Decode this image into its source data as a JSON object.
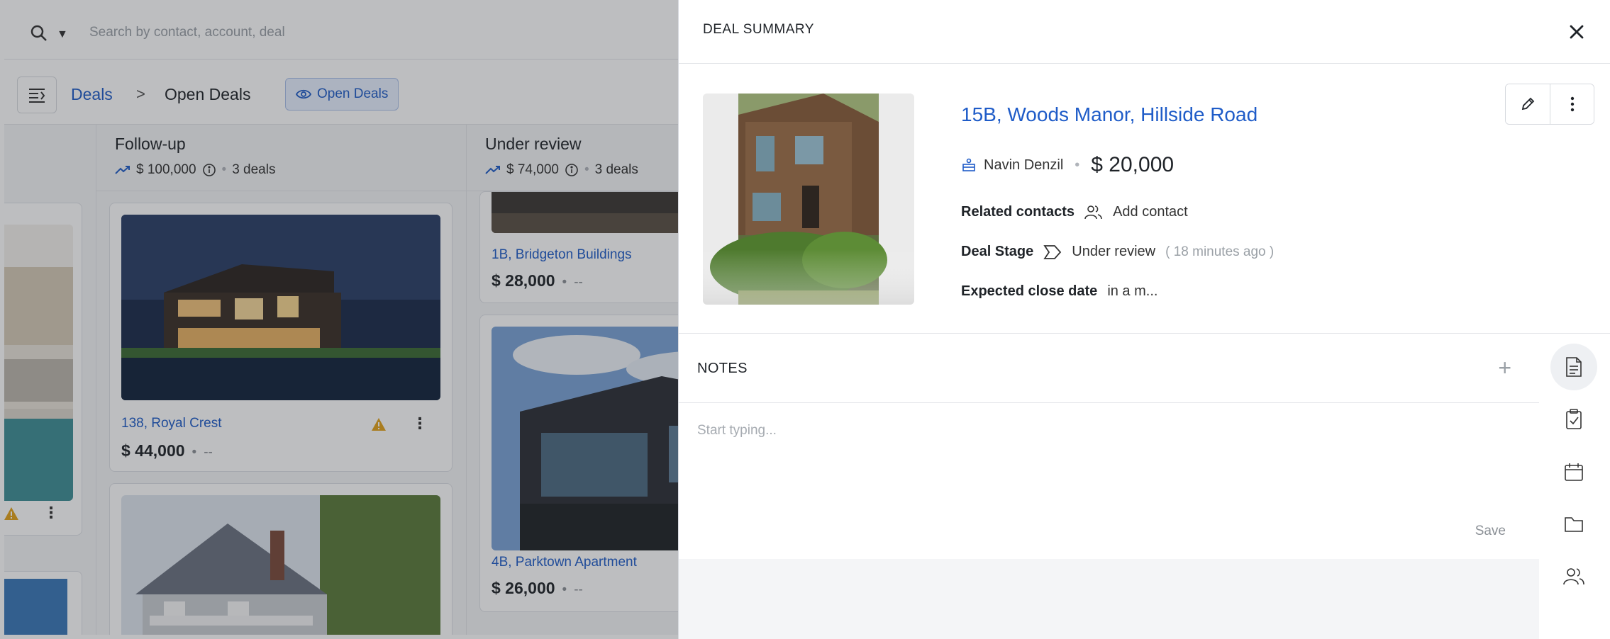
{
  "app": {
    "search": {
      "placeholder": "Search by contact, account, deal"
    },
    "breadcrumb": {
      "root": "Deals",
      "separator": ">",
      "current": "Open Deals"
    },
    "view_chip": "Open Deals",
    "columns": [
      {
        "title": "Follow-up",
        "total": "$ 100,000",
        "count": "3 deals",
        "cards": [
          {
            "name": "138, Royal Crest",
            "amount": "$ 44,000",
            "extra": "--"
          }
        ]
      },
      {
        "title": "Under review",
        "total": "$ 74,000",
        "count": "3 deals",
        "cards": [
          {
            "name": "1B, Bridgeton Buildings",
            "amount": "$ 28,000",
            "extra": "--"
          },
          {
            "name": "4B, Parktown Apartment",
            "amount": "$ 26,000",
            "extra": "--"
          }
        ]
      }
    ]
  },
  "panel": {
    "title": "DEAL SUMMARY",
    "deal_name": "15B, Woods Manor, Hillside Road",
    "owner": "Navin Denzil",
    "amount": "$ 20,000",
    "related_contacts_label": "Related contacts",
    "add_contact_label": "Add contact",
    "deal_stage_label": "Deal Stage",
    "deal_stage_value": "Under review",
    "deal_stage_time": "( 18 minutes ago )",
    "close_date_label": "Expected close date",
    "close_date_value": "in a m...",
    "notes": {
      "title": "NOTES",
      "add_symbol": "+",
      "placeholder": "Start typing...",
      "save_label": "Save"
    },
    "icons": [
      "close-icon",
      "edit-icon",
      "more-icon",
      "owner-icon",
      "contacts-icon",
      "stage-icon",
      "notes-icon",
      "tasks-icon",
      "calendar-icon",
      "folder-icon",
      "people-icon"
    ]
  },
  "colors": {
    "accent": "#1f5cc8",
    "overlay": "#232830"
  }
}
